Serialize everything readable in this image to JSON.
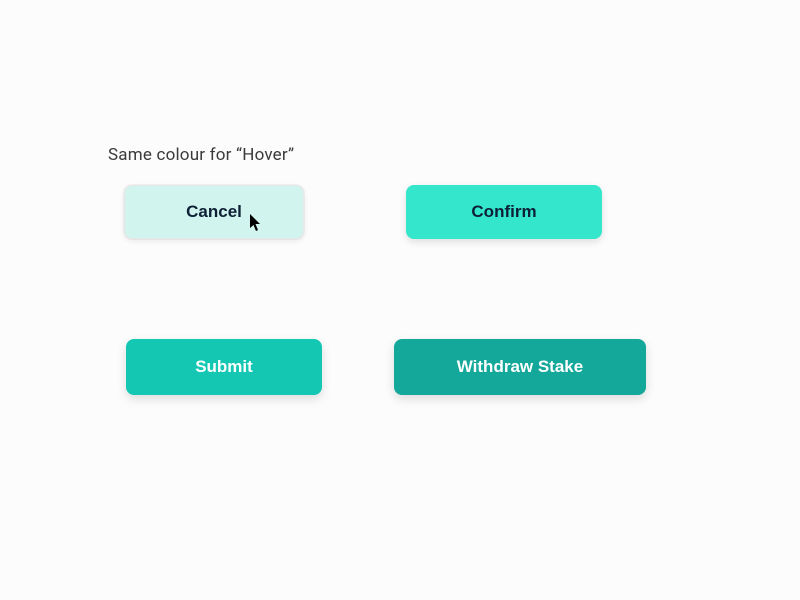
{
  "caption": "Same colour for “Hover”",
  "buttons": {
    "cancel": "Cancel",
    "confirm": "Confirm",
    "submit": "Submit",
    "withdraw": "Withdraw Stake"
  }
}
